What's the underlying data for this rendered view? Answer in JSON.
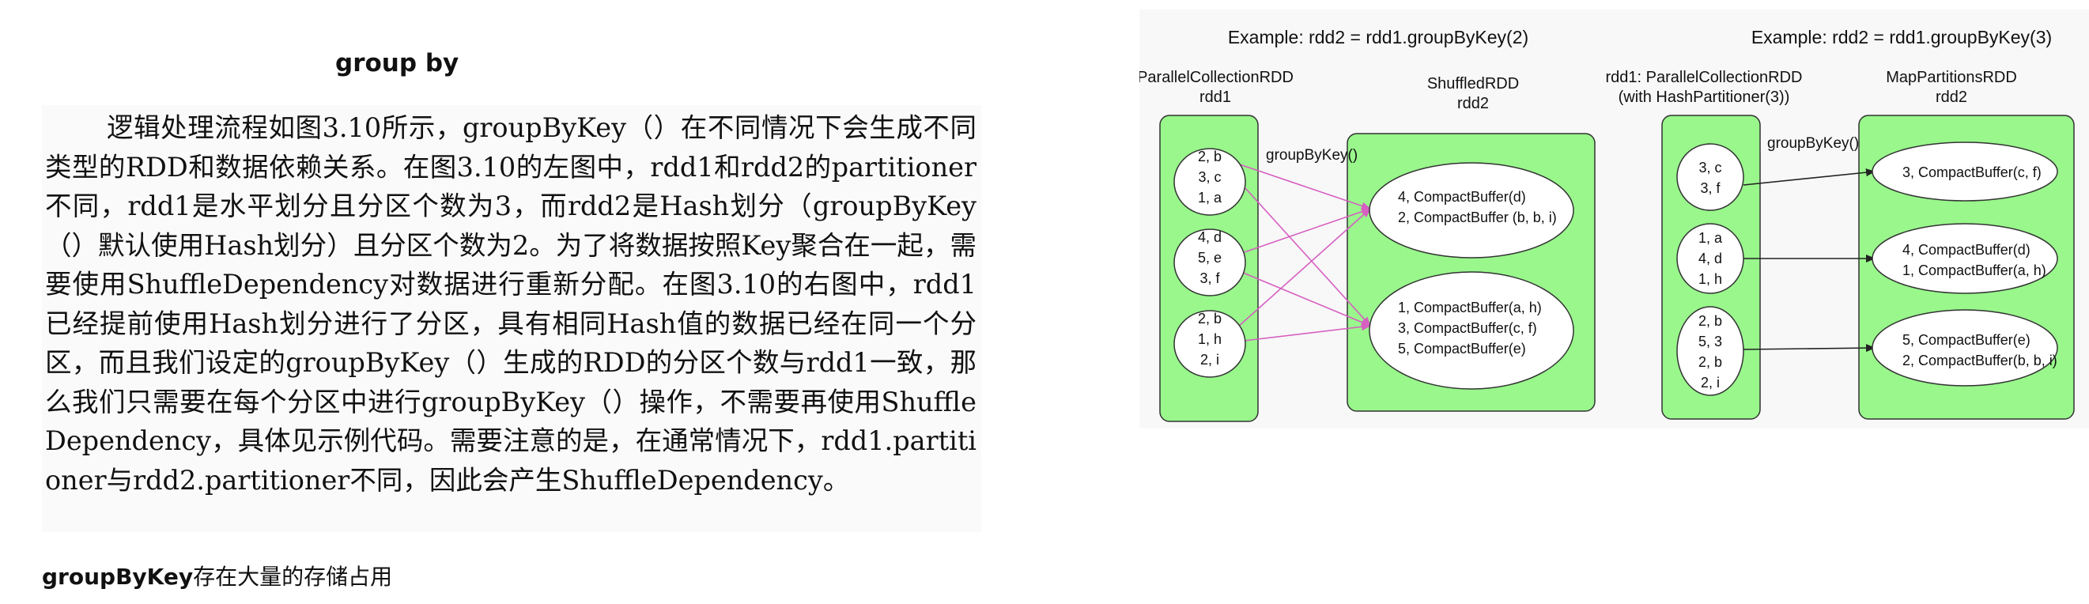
{
  "heading": "group by",
  "paragraph": "逻辑处理流程如图3.10所示，groupByKey（）在不同情况下会生成不同类型的RDD和数据依赖关系。在图3.10的左图中，rdd1和rdd2的partitioner不同，rdd1是水平划分且分区个数为3，而rdd2是Hash划分（groupByKey（）默认使用Hash划分）且分区个数为2。为了将数据按照Key聚合在一起，需要使用ShuffleDependency对数据进行重新分配。在图3.10的右图中，rdd1已经提前使用Hash划分进行了分区，具有相同Hash值的数据已经在同一个分区，而且我们设定的groupByKey（）生成的RDD的分区个数与rdd1一致，那么我们只需要在每个分区中进行groupByKey（）操作，不需要再使用ShuffleDependency，具体见示例代码。需要注意的是，在通常情况下，rdd1.partitioner与rdd2.partitioner不同，因此会产生ShuffleDependency。",
  "footnote": {
    "bold": "groupByKey",
    "rest": "存在大量的存储占用"
  },
  "colors": {
    "green_fill": "#99f78c",
    "arrow_pink": "#d65fc1"
  },
  "left_diagram": {
    "title": "Example: rdd2 = rdd1.groupByKey(2)",
    "rdd1_label_1": "ParallelCollectionRDD",
    "rdd1_label_2": "rdd1",
    "rdd2_label_1": "ShuffledRDD",
    "rdd2_label_2": "rdd2",
    "op_label": "groupByKey()",
    "rdd1_partitions": [
      [
        "2, b",
        "3, c",
        "1, a"
      ],
      [
        "4, d",
        "5, e",
        "3, f"
      ],
      [
        "2, b",
        "1, h",
        "2, i"
      ]
    ],
    "rdd2_partitions": [
      [
        "4, CompactBuffer(d)",
        "2, CompactBuffer (b, b, i)"
      ],
      [
        "1, CompactBuffer(a, h)",
        "3, CompactBuffer(c, f)",
        "5, CompactBuffer(e)"
      ]
    ]
  },
  "right_diagram": {
    "title": "Example: rdd2 = rdd1.groupByKey(3)",
    "rdd1_label_1": "rdd1: ParallelCollectionRDD",
    "rdd1_label_2": "(with HashPartitioner(3))",
    "rdd2_label_1": "MapPartitionsRDD",
    "rdd2_label_2": "rdd2",
    "op_label": "groupByKey()",
    "rdd1_partitions": [
      [
        "3, c",
        "3, f"
      ],
      [
        "1, a",
        "4, d",
        "1, h"
      ],
      [
        "2, b",
        "5, 3",
        "2, b",
        "2, i"
      ]
    ],
    "rdd2_partitions": [
      [
        "3, CompactBuffer(c, f)"
      ],
      [
        "4, CompactBuffer(d)",
        "1, CompactBuffer(a, h)"
      ],
      [
        "5, CompactBuffer(e)",
        "2, CompactBuffer(b, b, i)"
      ]
    ]
  }
}
